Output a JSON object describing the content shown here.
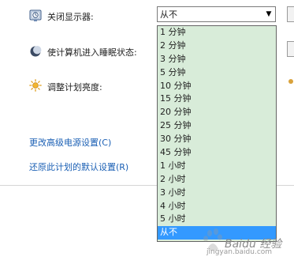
{
  "display": {
    "label": "关闭显示器:",
    "selected": "从不",
    "options": [
      "1 分钟",
      "2 分钟",
      "3 分钟",
      "5 分钟",
      "10 分钟",
      "15 分钟",
      "20 分钟",
      "25 分钟",
      "30 分钟",
      "45 分钟",
      "1 小时",
      "2 小时",
      "3 小时",
      "4 小时",
      "5 小时",
      "从不"
    ]
  },
  "sleep": {
    "label": "使计算机进入睡眠状态:"
  },
  "brightness": {
    "label": "调整计划亮度:"
  },
  "links": {
    "advanced": "更改高级电源设置(C)",
    "restore": "还原此计划的默认设置(R)"
  },
  "icons": {
    "display": "clock-icon",
    "sleep": "moon-icon",
    "brightness": "sun-icon",
    "select_arrow": "chevron-down-icon"
  },
  "colors": {
    "dropdown_bg": "#d8ecd9",
    "selected_bg": "#3399ff",
    "link": "#1a5fb4"
  },
  "watermark": {
    "text": "Baidu 经验",
    "sub": "jingyan.baidu.com"
  }
}
